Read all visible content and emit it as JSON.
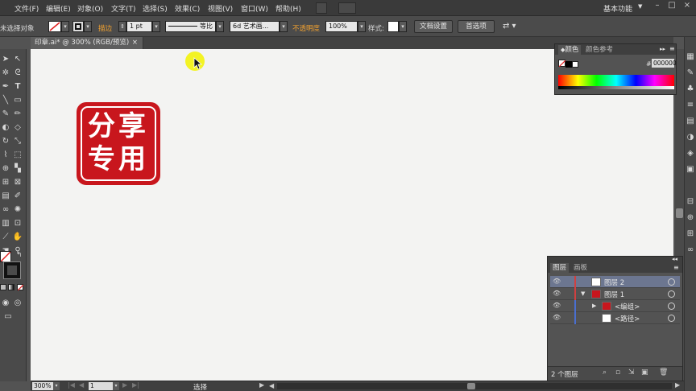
{
  "menu": {
    "items": [
      "文件(F)",
      "编辑(E)",
      "对象(O)",
      "文字(T)",
      "选择(S)",
      "效果(C)",
      "视图(V)",
      "窗口(W)",
      "帮助(H)"
    ],
    "workspace": "基本功能"
  },
  "control": {
    "selection_label": "未选择对象",
    "stroke_label": "描边",
    "stroke_weight": "1 pt",
    "stroke_profile": "等比",
    "brush": "6d 艺术画...",
    "opacity_label": "不透明度",
    "opacity_value": "100%",
    "style_label": "样式:",
    "doc_setup": "文档设置",
    "preferences": "首选项"
  },
  "document": {
    "tab_title": "印章.ai* @ 300% (RGB/预览)",
    "close": "×"
  },
  "stamp": {
    "chars": [
      "分",
      "享",
      "专",
      "用"
    ],
    "color": "#c8161d"
  },
  "color_panel": {
    "tab_color": "颜色",
    "tab_guide": "颜色参考",
    "hex_value": "000000"
  },
  "layers_panel": {
    "tab_layers": "图层",
    "tab_artboards": "画板",
    "rows": [
      {
        "name": "图层 2",
        "color": "#d04040"
      },
      {
        "name": "图层 1",
        "color": "#d04040"
      },
      {
        "name": "<编组>",
        "color": "#4a6fd0"
      },
      {
        "name": "<路径>",
        "color": "#4a6fd0"
      }
    ],
    "count": "2 个图层"
  },
  "status": {
    "zoom": "300%",
    "artboard": "1",
    "tool": "选择"
  },
  "icons": {
    "eye": "eye-icon",
    "target": "target-icon",
    "expand": "triangle-icon"
  }
}
